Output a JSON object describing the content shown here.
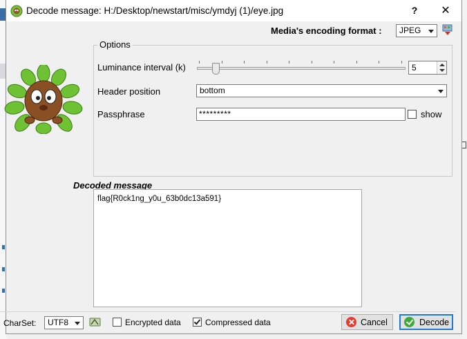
{
  "window": {
    "title": "Decode message: H:/Desktop/newstart/misc/ymdyj (1)/eye.jpg",
    "help_label": "?",
    "close_label": "✕"
  },
  "encoding_format": {
    "label": "Media's encoding format :",
    "value": "JPEG"
  },
  "options": {
    "legend": "Options",
    "luminance": {
      "label": "Luminance interval (k)",
      "value": "5",
      "slider_level_fraction": 0.1
    },
    "header_position": {
      "label": "Header position",
      "value": "bottom"
    },
    "passphrase": {
      "label": "Passphrase",
      "value": "*********",
      "show_label": "show",
      "show_checked": false
    }
  },
  "decoded": {
    "label": "Decoded message",
    "text": "flag{R0ck1ng_y0u_63b0dc13a591}"
  },
  "bottom": {
    "charset_label": "CharSet:",
    "charset_value": "UTF8",
    "encrypted_label": "Encrypted data",
    "encrypted_checked": false,
    "compressed_label": "Compressed data",
    "compressed_checked": true,
    "cancel_label": "Cancel",
    "decode_label": "Decode"
  },
  "icons": {
    "app": "app-icon",
    "format_tool": "format-settings-icon",
    "charset_tool": "charset-icon",
    "cancel": "cancel-icon",
    "decode": "decode-icon",
    "mascot": "mascot-illustration"
  },
  "colors": {
    "cancel_icon": "#e23a2e",
    "decode_icon": "#3ea83a",
    "default_button_border": "#1f7cd6"
  }
}
